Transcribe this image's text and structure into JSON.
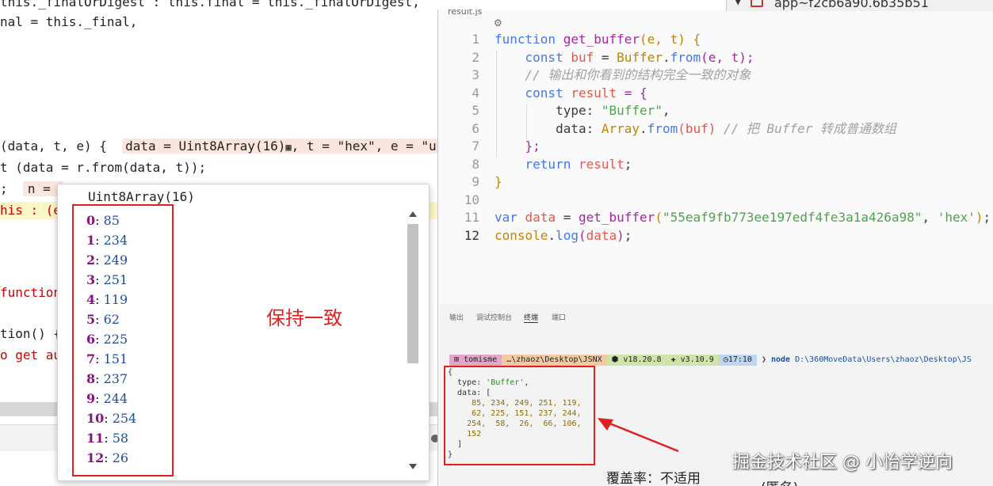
{
  "left_source": {
    "lines": [
      "this._finalOrDigest : this.final = this._finalOrDigest,",
      "nal = this._final,",
      "(data, t, e) {",
      "t (data = r.from(data, t));",
      ";",
      "his : (e",
      "function",
      "tion() {",
      "o get aut"
    ],
    "inline_values_1": "data = Uint8Array(16)",
    "inline_values_1b": ", t = \"hex\", e = \"u",
    "inline_values_2": "n = "
  },
  "popup": {
    "title": "Uint8Array(16)",
    "items": [
      {
        "key": "0",
        "value": "85"
      },
      {
        "key": "1",
        "value": "234"
      },
      {
        "key": "2",
        "value": "249"
      },
      {
        "key": "3",
        "value": "251"
      },
      {
        "key": "4",
        "value": "119"
      },
      {
        "key": "5",
        "value": "62"
      },
      {
        "key": "6",
        "value": "225"
      },
      {
        "key": "7",
        "value": "151"
      },
      {
        "key": "8",
        "value": "237"
      },
      {
        "key": "9",
        "value": "244"
      },
      {
        "key": "10",
        "value": "254"
      },
      {
        "key": "11",
        "value": "58"
      },
      {
        "key": "12",
        "value": "26"
      }
    ]
  },
  "annotation": "保持一致",
  "editor": {
    "breadcrumb": "result.js",
    "breadcrumb_icon": "⚙",
    "line_numbers": [
      "1",
      "2",
      "3",
      "4",
      "5",
      "6",
      "7",
      "8",
      "9",
      "10",
      "11",
      "12"
    ],
    "code": {
      "l1_kw": "function",
      "l1_name": "get_buffer",
      "l1_rest": "(e, t) {",
      "l2_kw": "const",
      "l2_var": "buf",
      "l2_eq": " = ",
      "l2_cls": "Buffer",
      "l2_from": "from",
      "l2_args": "(e, t);",
      "l3_comment": "// 输出和你看到的结构完全一致的对象",
      "l4_kw": "const",
      "l4_var": "result",
      "l4_rest": " = {",
      "l5_key": "type",
      "l5_val": "\"Buffer\"",
      "l6_key": "data",
      "l6_cls": "Array",
      "l6_from": "from",
      "l6_arg": "(buf)",
      "l6_comment": "// 把 Buffer 转成普通数组",
      "l7": "};",
      "l8_kw": "return",
      "l8_var": "result",
      "l9": "}",
      "l11_kw": "var",
      "l11_var": "data",
      "l11_fn": "get_buffer",
      "l11_s1": "\"55eaf9fb773ee197edf4fe3a1a426a98\"",
      "l11_s2": "'hex'",
      "l12_obj": "console",
      "l12_fn": "log",
      "l12_arg": "data"
    }
  },
  "right_strip": "app~f2cb6a90.6b35b51",
  "panel": {
    "tabs": [
      "输出",
      "调试控制台",
      "终端",
      "端口"
    ],
    "active_tab": "终端",
    "prompt": {
      "user": "tomisme",
      "path": "…\\zhaoz\\Desktop\\JSNX",
      "node": "v18.20.8",
      "python": "v3.10.9",
      "time": "17:10",
      "command": "node",
      "cmd_path": "D:\\360MoveData\\Users\\zhaoz\\Desktop\\JS"
    },
    "output": {
      "open": "{",
      "type_key": "  type: ",
      "type_val": "'Buffer'",
      "comma": ",",
      "data_key": "  data: [",
      "row1": "     85, 234, 249, 251, 119,",
      "row2": "     62, 225, 151, 237, 244,",
      "row3": "    254,  58,  26,  66, 106,",
      "row4": "    152",
      "close_arr": "  ]",
      "close": "}"
    }
  },
  "watermark": "掘金技术社区 @ 小怡学逆向",
  "coverage": "覆盖率：不适用",
  "anon": "(匿名)",
  "colors": {
    "annotation_red": "#e02020",
    "popup_key": "#881280",
    "popup_value": "#1c4e99"
  }
}
